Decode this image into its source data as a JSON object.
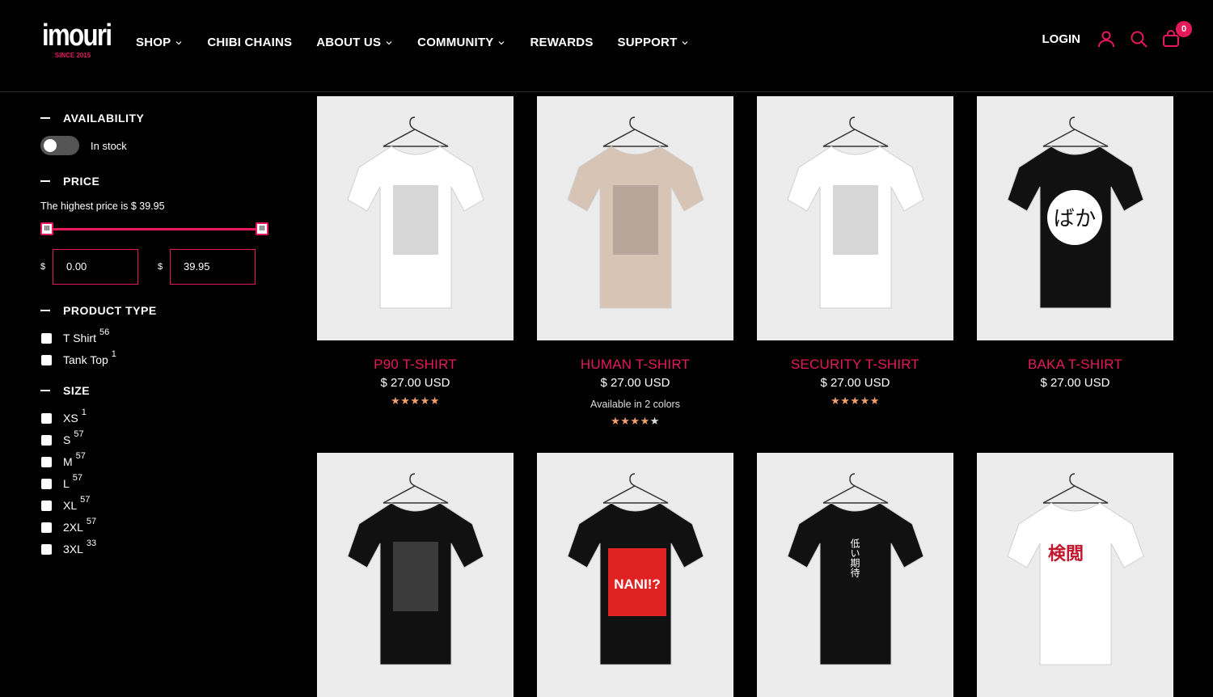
{
  "brand": {
    "name": "imouri",
    "tagline": "SINCE 2015"
  },
  "nav": [
    {
      "label": "SHOP",
      "dropdown": true
    },
    {
      "label": "CHIBI CHAINS",
      "dropdown": false
    },
    {
      "label": "ABOUT US",
      "dropdown": true
    },
    {
      "label": "COMMUNITY",
      "dropdown": true
    },
    {
      "label": "REWARDS",
      "dropdown": false
    },
    {
      "label": "SUPPORT",
      "dropdown": true
    }
  ],
  "header": {
    "login": "LOGIN",
    "cart_count": "0",
    "accent": "#e6195d"
  },
  "filters": {
    "availability": {
      "heading": "AVAILABILITY",
      "toggle_label": "In stock",
      "on": false
    },
    "price": {
      "heading": "PRICE",
      "note": "The highest price is $ 39.95",
      "currency": "$",
      "min": "0.00",
      "max": "39.95",
      "range_low": 0,
      "range_high": 1
    },
    "product_type": {
      "heading": "PRODUCT TYPE",
      "options": [
        {
          "label": "T Shirt",
          "count": "56"
        },
        {
          "label": "Tank Top",
          "count": "1"
        }
      ]
    },
    "size": {
      "heading": "SIZE",
      "options": [
        {
          "label": "XS",
          "count": "1"
        },
        {
          "label": "S",
          "count": "57"
        },
        {
          "label": "M",
          "count": "57"
        },
        {
          "label": "L",
          "count": "57"
        },
        {
          "label": "XL",
          "count": "57"
        },
        {
          "label": "2XL",
          "count": "57"
        },
        {
          "label": "3XL",
          "count": "33"
        }
      ]
    }
  },
  "products": [
    {
      "title": "P90 T-SHIRT",
      "price": "$ 27.00 USD",
      "colors": "",
      "rating": 5,
      "shirt_color": "#ffffff"
    },
    {
      "title": "HUMAN T-SHIRT",
      "price": "$ 27.00 USD",
      "colors": "Available in 2 colors",
      "rating": 4,
      "shirt_color": "#d8c4b4"
    },
    {
      "title": "SECURITY T-SHIRT",
      "price": "$ 27.00 USD",
      "colors": "",
      "rating": 5,
      "shirt_color": "#ffffff"
    },
    {
      "title": "BAKA T-SHIRT",
      "price": "$ 27.00 USD",
      "colors": "",
      "rating": 0,
      "shirt_color": "#111111",
      "print_text": "ばか"
    },
    {
      "title": "",
      "price": "",
      "colors": "",
      "rating": 0,
      "shirt_color": "#111111"
    },
    {
      "title": "",
      "price": "",
      "colors": "",
      "rating": 0,
      "shirt_color": "#111111",
      "print_text": "NANI!?"
    },
    {
      "title": "",
      "price": "",
      "colors": "",
      "rating": 0,
      "shirt_color": "#111111",
      "print_text": "低い期待"
    },
    {
      "title": "",
      "price": "",
      "colors": "",
      "rating": 0,
      "shirt_color": "#ffffff",
      "print_text": "検閲"
    }
  ]
}
